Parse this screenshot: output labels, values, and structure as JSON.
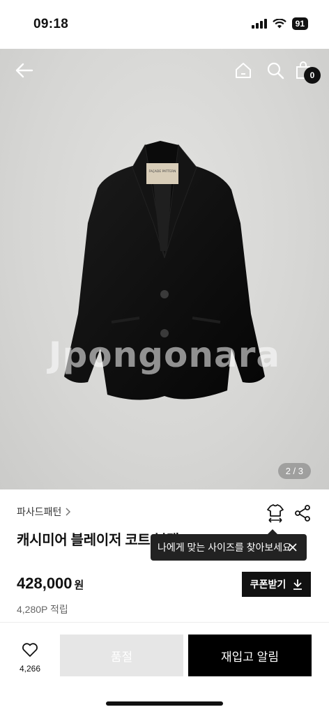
{
  "status_bar": {
    "time": "09:18",
    "battery": "91"
  },
  "header": {
    "cart_count": "0"
  },
  "hero": {
    "watermark": "Jpongonara",
    "pager": "2 / 3",
    "label_brand": "FAÇADE PATTERN"
  },
  "product": {
    "brand": "파사드패턴",
    "title": "캐시미어 블레이저 코트 블랙",
    "price": "428,000",
    "currency": "원",
    "points": "4,280P 적립",
    "coupon_label": "쿠폰받기"
  },
  "tooltip": {
    "text": "나에게 맞는 사이즈를 찾아보세요"
  },
  "bottom_bar": {
    "wish_count": "4,266",
    "soldout_label": "품절",
    "restock_label": "재입고 알림"
  },
  "colors": {
    "accent": "#000000",
    "disabled": "#e6e6e6",
    "tooltip_bg": "#222222"
  },
  "icons": [
    "back-arrow-icon",
    "home-icon",
    "search-icon",
    "shopping-bag-icon",
    "chevron-right-icon",
    "size-fit-icon",
    "share-icon",
    "close-icon",
    "download-icon",
    "heart-icon"
  ]
}
